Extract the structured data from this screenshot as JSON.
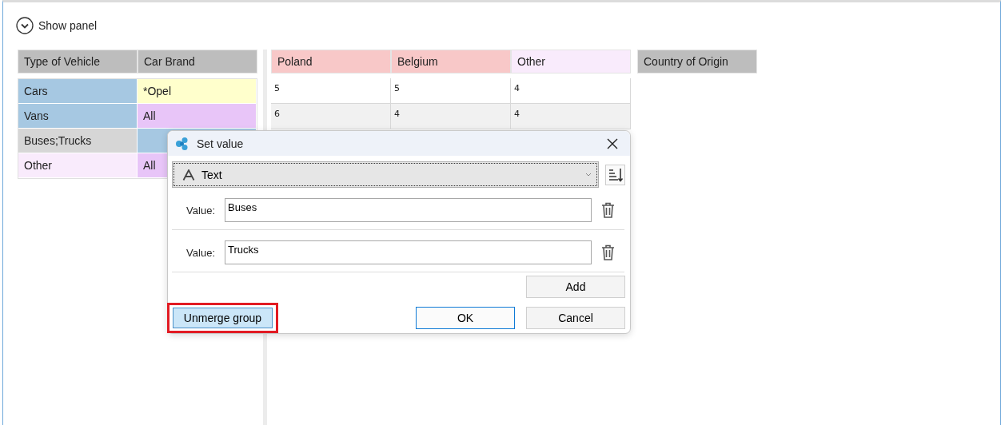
{
  "show_panel": {
    "label": "Show panel"
  },
  "row_headers": {
    "columns": [
      {
        "label": "Type of Vehicle"
      },
      {
        "label": "Car Brand"
      }
    ],
    "rows": [
      {
        "cells": [
          {
            "text": "Cars",
            "color": "#a6c8e2"
          },
          {
            "text": "*Opel",
            "color": "#ffffcc"
          }
        ]
      },
      {
        "cells": [
          {
            "text": "Vans",
            "color": "#a6c8e2"
          },
          {
            "text": "All",
            "color": "#e8c5f8"
          }
        ]
      },
      {
        "cells": [
          {
            "text": "Buses;Trucks",
            "color": "#d6d6d6"
          },
          {
            "color": "#a6c8e2"
          }
        ]
      },
      {
        "cells": [
          {
            "text": "Other",
            "color": "#f9ebfc"
          },
          {
            "text": "All",
            "color": "#e8c5f8"
          }
        ]
      }
    ]
  },
  "column_headers": [
    {
      "label": "Poland",
      "color": "#f8c8c8"
    },
    {
      "label": "Belgium",
      "color": "#f8c8c8"
    },
    {
      "label": "Other",
      "color": "#f9ebfc"
    }
  ],
  "data_rows": [
    {
      "cells": [
        "5",
        "5",
        "4"
      ]
    },
    {
      "cells": [
        "6",
        "4",
        "4"
      ]
    }
  ],
  "country_field": {
    "label": "Country of Origin"
  },
  "dialog": {
    "title": "Set value",
    "type_dropdown": {
      "value": "Text"
    },
    "values": [
      {
        "label": "Value:",
        "value": "Buses"
      },
      {
        "label": "Value:",
        "value": "Trucks"
      }
    ],
    "add_button": {
      "label": "Add"
    },
    "unmerge_button": {
      "label": "Unmerge group",
      "highlighted": true
    },
    "ok_button": {
      "label": "OK",
      "default": true
    },
    "cancel_button": {
      "label": "Cancel",
      "default": false
    }
  }
}
